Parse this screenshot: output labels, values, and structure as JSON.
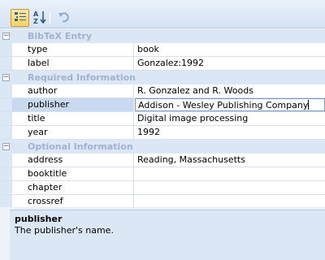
{
  "toolbar": {
    "categorized_icon": "categorized-icon",
    "alphabetical_icon": "sort-alphabetical-icon",
    "undo_icon": "undo-icon"
  },
  "categories": [
    {
      "label": "BibTeX Entry",
      "properties": [
        {
          "name": "type",
          "value": "book"
        },
        {
          "name": "label",
          "value": "Gonzalez:1992"
        }
      ]
    },
    {
      "label": "Required Information",
      "properties": [
        {
          "name": "author",
          "value": "R. Gonzalez and R. Woods"
        },
        {
          "name": "publisher",
          "value": "Addison - Wesley Publishing Company"
        },
        {
          "name": "title",
          "value": "Digital image processing"
        },
        {
          "name": "year",
          "value": "1992"
        }
      ]
    },
    {
      "label": "Optional Information",
      "properties": [
        {
          "name": "address",
          "value": "Reading, Massachusetts"
        },
        {
          "name": "booktitle",
          "value": ""
        },
        {
          "name": "chapter",
          "value": ""
        },
        {
          "name": "crossref",
          "value": ""
        }
      ]
    }
  ],
  "selected_property": "publisher",
  "description": {
    "title": "publisher",
    "text": "The publisher's name."
  },
  "colors": {
    "category_text": "#9fb3cf",
    "selection": "#c9d9ef",
    "active_button": "#ffd35e"
  }
}
